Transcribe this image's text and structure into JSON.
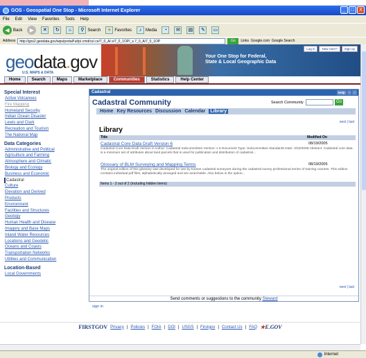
{
  "window": {
    "title": "GOS - Geospatial One Stop - Microsoft Internet Explorer",
    "min": "_",
    "max": "□",
    "close": "X"
  },
  "menu": [
    "File",
    "Edit",
    "View",
    "Favorites",
    "Tools",
    "Help"
  ],
  "toolbar": {
    "back": "Back",
    "search": "Search",
    "favorites": "Favorites",
    "media": "Media"
  },
  "address": {
    "label": "Address",
    "url": "http://gos2.geodata.gov/wps/portal/!ut/p/.cmd/cs/.ce/7_0_A/.s/7_0_1OP/_s.7_0_A/7_0_1OP",
    "go": "Go",
    "links": "Links",
    "google": "Google.com",
    "google_search": "Google Search"
  },
  "header": {
    "logo_geo": "geo",
    "logo_data": "data",
    "logo_dot": ".",
    "logo_gov": "gov",
    "logo_sub": "U.S. MAPS & DATA",
    "banner_line1": "Your One Stop for Federal,",
    "banner_line2": "State & Local Geographic Data",
    "links": [
      "Log in",
      "New User?",
      "Sign up"
    ]
  },
  "nav": [
    "Home",
    "Search",
    "Maps",
    "Marketplace",
    "Communities",
    "Statistics",
    "Help Center"
  ],
  "sidebar": {
    "special_head": "Special Interest",
    "special": [
      "Active Volcanoes",
      "Fire Mapping",
      "Homeland Security",
      "Indian Ocean Disaster",
      "Lewis and Clark",
      "Recreation and Tourism",
      "The National Map"
    ],
    "categories_head": "Data Categories",
    "categories": [
      "Administrative and Political",
      "Agriculture and Farming",
      "Atmosphere and Climatic",
      "Biology and Ecology",
      "Business and Economic",
      "Cadastral",
      "Culture",
      "Elevation and Derived",
      "Products",
      "Environment",
      "Facilities and Structures",
      "Geology",
      "Human Health and Disease",
      "Imagery and Base Maps",
      "Inland Water Resources",
      "Locations and Geodetic",
      "Oceans and Coasts",
      "Transportation Networks",
      "Utilities and Communication"
    ],
    "location_head": "Location-Based",
    "location": [
      "Local Governments"
    ]
  },
  "panel": {
    "title": "Cadastral",
    "ctrl_help": "Help",
    "ctrl_min": "–",
    "ctrl_close": "□",
    "community_title": "Cadastral Community",
    "search_label": "Search Community",
    "search_go": "Go",
    "subnav": [
      "Home",
      "Key Resources",
      "Discussion",
      "Calendar",
      "Library"
    ],
    "pager": "next | last",
    "library_title": "Library",
    "col_title": "Title",
    "col_modified": "Modified On",
    "items": [
      {
        "title": "Cadastral Core Data Draft Version 6",
        "date": "08/19/2005",
        "desc": "Cadastral Core Data Draft Version 6 Author: Cadastral Subcommittee Version: v 6 Document Type: Subcommittee Standards Date: 3/23/2005 Abstract: Cadastral core data is a minimum set of attributes about land parcels that is used for publication and distribution of cadastral..."
      },
      {
        "title": "Glossary of BLM Surveying and Mapping Terms",
        "date": "08/19/2005",
        "desc": "The original edition of this glossary was developed for use by trainee cadastral surveyors during the cadastral survey professional series of training courses. This edition contains individual pdf files, alphabetically arranged and are searchable. Also below is the option..."
      }
    ],
    "items_footer": "Items 1 - 2 out of 2 (including hidden items)",
    "comments_text": "Send comments or suggestions to the community",
    "comments_link": "Steward",
    "signin": "sign in"
  },
  "footer": {
    "firstgov": "FIRSTGOV",
    "links": [
      "Privacy",
      "Policies",
      "FOIA",
      "DOI",
      "USGS",
      "Firstgov",
      "Contact Us",
      "FAQ"
    ],
    "egov": "E.GOV"
  },
  "status": {
    "zone": "Internet"
  }
}
